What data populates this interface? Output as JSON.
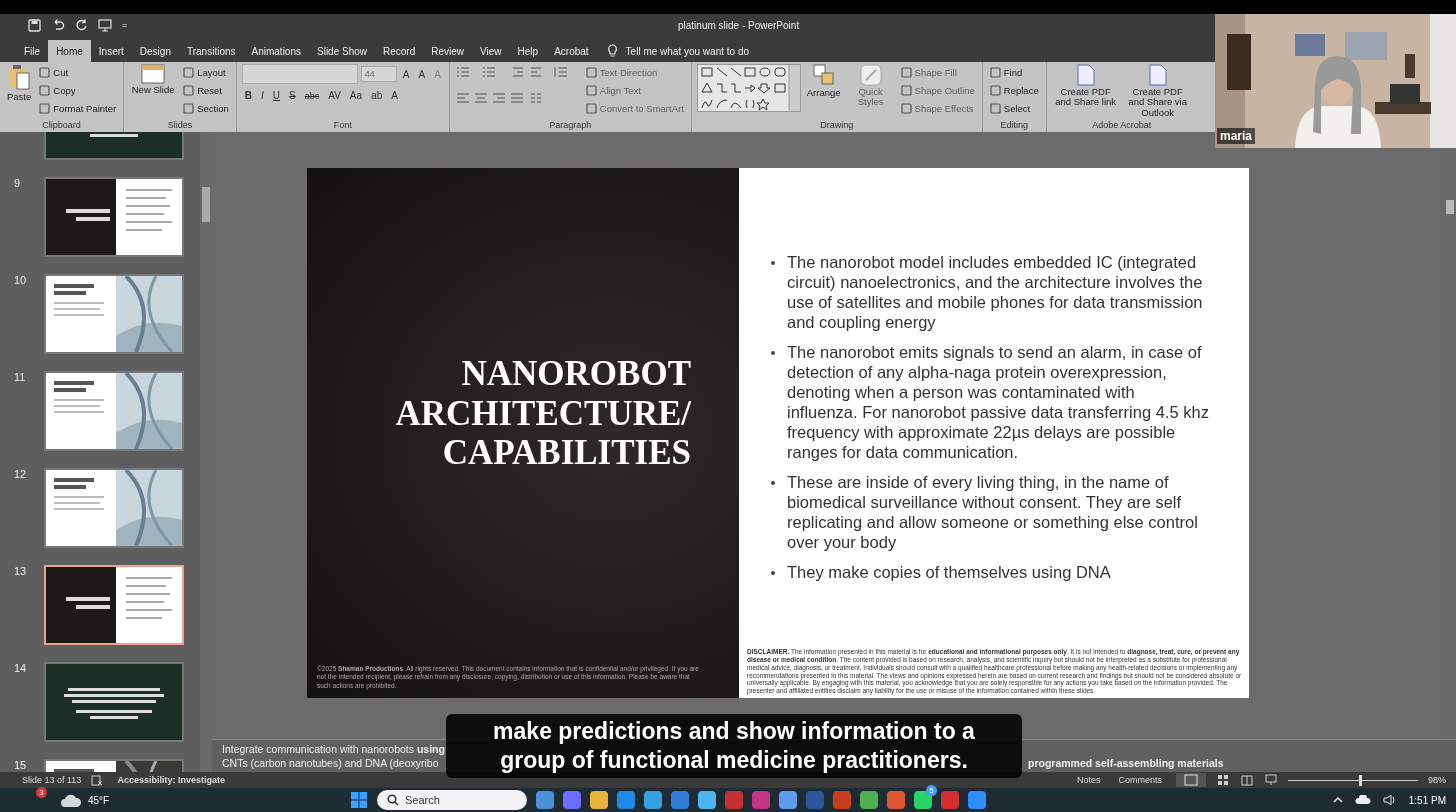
{
  "quick_access": {
    "overflow": "="
  },
  "window": {
    "title": "platinum slide  -  PowerPoint"
  },
  "tabs": [
    {
      "label": "File",
      "selected": false
    },
    {
      "label": "Home",
      "selected": true
    },
    {
      "label": "Insert",
      "selected": false
    },
    {
      "label": "Design",
      "selected": false
    },
    {
      "label": "Transitions",
      "selected": false
    },
    {
      "label": "Animations",
      "selected": false
    },
    {
      "label": "Slide Show",
      "selected": false
    },
    {
      "label": "Record",
      "selected": false
    },
    {
      "label": "Review",
      "selected": false
    },
    {
      "label": "View",
      "selected": false
    },
    {
      "label": "Help",
      "selected": false
    },
    {
      "label": "Acrobat",
      "selected": false
    }
  ],
  "tell_me": {
    "placeholder": "Tell me what you want to do"
  },
  "ribbon": {
    "clipboard": {
      "name": "Clipboard",
      "large": "Paste",
      "items": [
        {
          "label": "Cut",
          "disabled": false
        },
        {
          "label": "Copy",
          "disabled": false
        },
        {
          "label": "Format Painter",
          "disabled": false
        }
      ]
    },
    "slides": {
      "name": "Slides",
      "large": "New Slide",
      "items": [
        {
          "label": "Layout",
          "disabled": false
        },
        {
          "label": "Reset",
          "disabled": false
        },
        {
          "label": "Section",
          "disabled": false
        }
      ]
    },
    "font": {
      "name": "Font",
      "size": "44",
      "grow": [
        "A",
        "A"
      ],
      "clear": "A",
      "styles": [
        "B",
        "I",
        "U",
        "S",
        "abc",
        "AV",
        "Aa",
        "ab",
        "A"
      ]
    },
    "paragraph": {
      "name": "Paragraph",
      "items": [
        {
          "label": "Text Direction",
          "disabled": true
        },
        {
          "label": "Align Text",
          "disabled": true
        },
        {
          "label": "Convert to SmartArt",
          "disabled": true
        }
      ]
    },
    "drawing": {
      "name": "Drawing",
      "arrange": "Arrange",
      "quick_styles": "Quick Styles",
      "items": [
        {
          "label": "Shape Fill",
          "disabled": true
        },
        {
          "label": "Shape Outline",
          "disabled": true
        },
        {
          "label": "Shape Effects",
          "disabled": true
        }
      ]
    },
    "editing": {
      "name": "Editing",
      "items": [
        {
          "label": "Find",
          "disabled": false
        },
        {
          "label": "Replace",
          "disabled": false
        },
        {
          "label": "Select",
          "disabled": false
        }
      ]
    },
    "acrobat": {
      "name": "Adobe Acrobat",
      "items": [
        "Create PDF and Share link",
        "Create PDF and Share via Outlook"
      ]
    }
  },
  "webcam": {
    "name": "maria"
  },
  "thumbnails": [
    {
      "kind": "green",
      "selected": false
    },
    {
      "number": "9",
      "kind": "split",
      "selected": false
    },
    {
      "number": "10",
      "selected": false
    },
    {
      "number": "11",
      "selected": false
    },
    {
      "number": "12",
      "selected": false
    },
    {
      "number": "13",
      "kind": "split",
      "selected": true
    },
    {
      "number": "14",
      "kind": "green",
      "selected": false
    },
    {
      "number": "15",
      "selected": false
    }
  ],
  "slide": {
    "title": "NANOROBOT ARCHITECTURE/ CAPABILITIES",
    "copyright": "©2025 **Shaman Productions**. All rights reserved. This document contains information that is confidential and/or privileged. If you are not the intended recipient, please refrain from any disclosure, copying, distribution or use of this information. Please be aware that such actions are prohibited.",
    "bullets": [
      "The nanorobot model includes embedded IC (integrated circuit) nanoelectronics, and the architecture involves the use of satellites and mobile phones for data transmission and coupling energy",
      "The nanorobot emits signals to send an alarm, in case of detection of any alpha-naga protein overexpression, denoting when a person was contaminated with influenza. For nanorobot passive data transferring 4.5 khz frequency with approximate 22µs delays are possible ranges for data communication.",
      "These are inside of every living thing, in the name of biomedical surveillance without consent. They are self replicating and allow someone or something else control over your body",
      "They make copies of themselves using DNA"
    ],
    "disclaimer": "**DISCLAIMER.** The information presented in this material is for **educational and informational purposes only**. It is not intended to **diagnose, treat, cure, or prevent any disease or medical condition**. The content provided is based on research, analysis, and scientific inquiry but should not be interpreted as a substitute for professional medical advice, diagnosis, or treatment. Individuals should consult with a qualified healthcare professional before making any health-related decisions or implementing any recommendations presented in this material. The views and opinions expressed herein are based on current research and findings but should not be considered absolute or universally applicable. By engaging with this material, you acknowledge that you are solely responsible for any actions you take based on the information provided. The presenter and affiliated entities disclaim any liability for the use or misuse of the information contained within these slides."
  },
  "notes": {
    "line_1": "Integrate communication with nanorobots **using**",
    "line_2_left": "CNTs (carbon nanotubes) and DNA (deoxyribo",
    "line_2_right": "programmed self-assembling materials"
  },
  "caption": {
    "lines": [
      "make predictions and show information to a",
      "group of functional medicine practitioners."
    ]
  },
  "status_bar": {
    "slide": "Slide 13 of 113",
    "accessibility": "Accessibility: Investigate",
    "notes": "Notes",
    "comments": "Comments",
    "zoom": "98%",
    "level": 0.55
  },
  "taskbar": {
    "weather_badge": "3",
    "temperature": "45°F",
    "search": {
      "placeholder": "Search"
    },
    "apps": [
      {
        "color": "#4a90d9"
      },
      {
        "color": "#6c6cff"
      },
      {
        "color": "#e8b23a"
      },
      {
        "color": "#1e88e5"
      },
      {
        "color": "#35a0e0"
      },
      {
        "color": "#2e7bd6"
      },
      {
        "color": "#4bb5f0"
      },
      {
        "color": "#c53030"
      },
      {
        "color": "#c13584"
      },
      {
        "color": "#5d9cec"
      },
      {
        "color": "#2b579a"
      },
      {
        "color": "#c43e1c"
      },
      {
        "color": "#4caf50"
      },
      {
        "color": "#de5833"
      },
      {
        "color": "#25d366",
        "badge": "5"
      },
      {
        "color": "#d32f2f"
      },
      {
        "color": "#2d8cff"
      }
    ],
    "time": "1:51 PM"
  }
}
